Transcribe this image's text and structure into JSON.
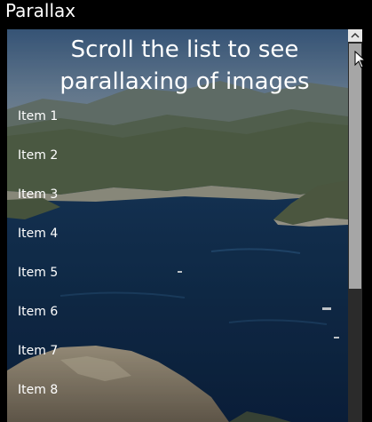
{
  "window": {
    "title": "Parallax"
  },
  "content": {
    "heading_line1": "Scroll the list to see",
    "heading_line2": "parallaxing of images",
    "items": [
      {
        "label": "Item 1"
      },
      {
        "label": "Item 2"
      },
      {
        "label": "Item 3"
      },
      {
        "label": "Item 4"
      },
      {
        "label": "Item 5"
      },
      {
        "label": "Item 6"
      },
      {
        "label": "Item 7"
      },
      {
        "label": "Item 8"
      }
    ]
  },
  "scrollbar": {
    "up_icon": "chevron-up-icon",
    "position_fraction": 0.0
  },
  "colors": {
    "background": "#000000",
    "text": "#ffffff",
    "scroll_track": "#2b2b2b",
    "scroll_thumb": "#a6a6a6"
  },
  "background_image": {
    "icon": "coastal-landscape-photo"
  }
}
